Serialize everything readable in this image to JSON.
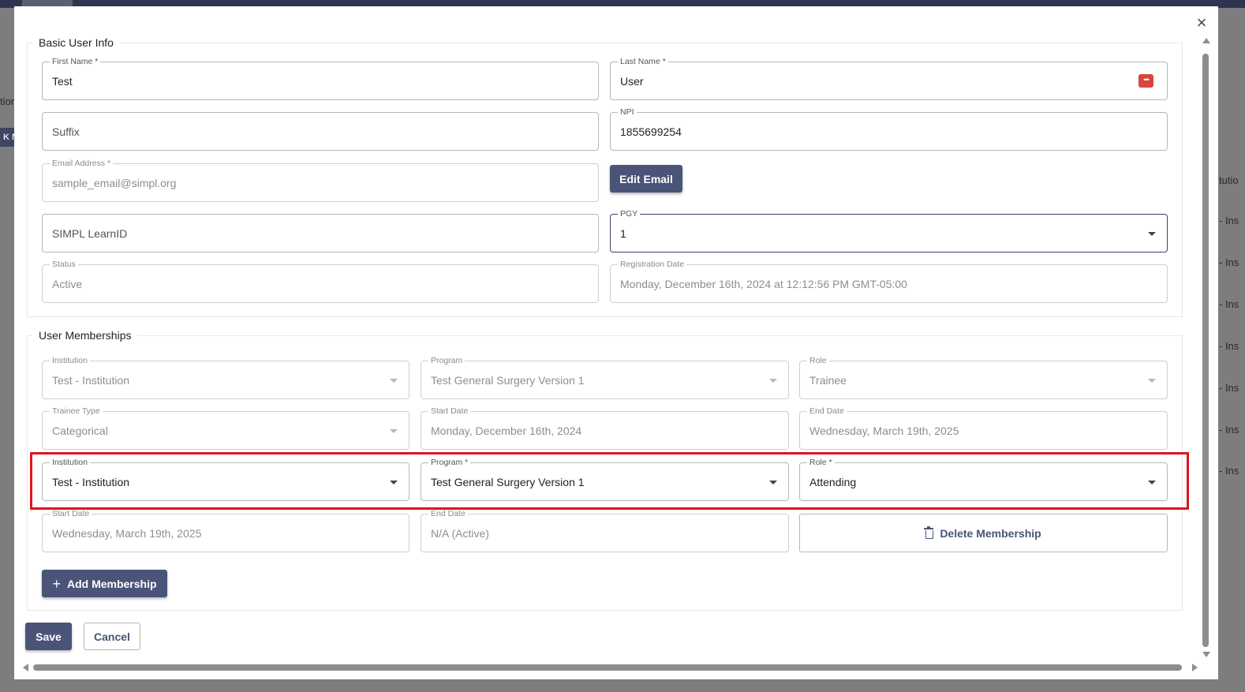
{
  "background": {
    "left_texts": [
      "tior",
      "K NE"
    ],
    "right_header": "tutio",
    "right_rows": [
      "- Ins",
      "- Ins",
      "- Ins",
      "- Ins",
      "- Ins",
      "- Ins",
      "- Ins"
    ]
  },
  "dialog": {
    "close_label": "×",
    "basic_info": {
      "title": "Basic User Info",
      "first_name": {
        "label": "First Name *",
        "value": "Test"
      },
      "last_name": {
        "label": "Last Name *",
        "value": "User"
      },
      "suffix": {
        "placeholder": "Suffix"
      },
      "npi": {
        "label": "NPI",
        "value": "1855699254"
      },
      "email": {
        "label": "Email Address *",
        "value": "sample_email@simpl.org"
      },
      "edit_email_label": "Edit Email",
      "learn_id": {
        "placeholder": "SIMPL LearnID"
      },
      "pgy": {
        "label": "PGY",
        "value": "1"
      },
      "status": {
        "label": "Status",
        "value": "Active"
      },
      "registration_date": {
        "label": "Registration Date",
        "value": "Monday, December 16th, 2024 at 12:12:56 PM GMT-05:00"
      }
    },
    "memberships": {
      "title": "User Memberships",
      "existing": {
        "institution": {
          "label": "Institution",
          "value": "Test - Institution"
        },
        "program": {
          "label": "Program",
          "value": "Test General Surgery Version 1"
        },
        "role": {
          "label": "Role",
          "value": "Trainee"
        },
        "trainee_type": {
          "label": "Trainee Type",
          "value": "Categorical"
        },
        "start_date": {
          "label": "Start Date",
          "value": "Monday, December 16th, 2024"
        },
        "end_date": {
          "label": "End Date",
          "value": "Wednesday, March 19th, 2025"
        }
      },
      "new": {
        "institution": {
          "label": "Institution",
          "value": "Test - Institution"
        },
        "program": {
          "label": "Program *",
          "value": "Test General Surgery Version 1"
        },
        "role": {
          "label": "Role *",
          "value": "Attending"
        },
        "start_date": {
          "label": "Start Date",
          "value": "Wednesday, March 19th, 2025"
        },
        "end_date": {
          "label": "End Date",
          "value": "N/A (Active)"
        }
      },
      "delete_label": "Delete Membership",
      "add_label": "Add Membership",
      "add_icon": "+"
    },
    "save_label": "Save",
    "cancel_label": "Cancel"
  },
  "colors": {
    "primary": "#4a5478",
    "highlight": "#e0141c",
    "password_icon": "#d9453c"
  }
}
